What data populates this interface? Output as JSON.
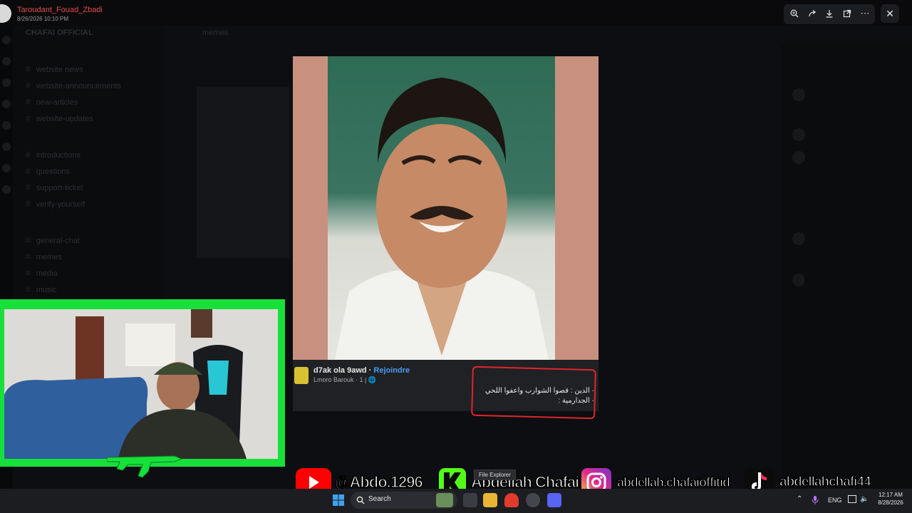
{
  "topbar": {
    "username": "Taroudant_Fouad_Zbadi",
    "timestamp": "8/26/2026 10:10 PM",
    "actions": [
      "zoom-in-icon",
      "forward-icon",
      "download-icon",
      "open-external-icon",
      "more-icon"
    ]
  },
  "discord_bg": {
    "server_name": "CHAFAI OFFICIAL",
    "channel_header": "memes",
    "channels": [
      "website news",
      "website-announcements",
      "new-articles",
      "website-updates",
      "introductions",
      "questions",
      "support-ticket",
      "verify-yourself",
      "general-chat",
      "memes",
      "media",
      "music"
    ]
  },
  "post": {
    "page_name": "d7ak ola 9awd",
    "separator": "·",
    "join_label": "Rejoindre",
    "author": "Lmoro Barouk",
    "age": "1 j",
    "caption_line1": "· الدين : قصوا الشوارب واعفوا اللحي",
    "caption_line2": "· الجدارمية :"
  },
  "social": {
    "youtube": "@Abdo.1296",
    "kick": "Abdellah Chafai",
    "instagram": "abdellah.chafaioffitid",
    "tiktok": "abdellahchafi44"
  },
  "taskbar": {
    "tooltip": "File Explorer",
    "search_placeholder": "Search",
    "language": "ENG",
    "time": "12:17 AM",
    "date": "8/28/2026"
  },
  "colors": {
    "youtube": "#ff0000",
    "kick": "#53fc18",
    "webcam_frame": "#18e03a",
    "highlight_box": "#e0252d",
    "join_link": "#4a9cf0"
  }
}
